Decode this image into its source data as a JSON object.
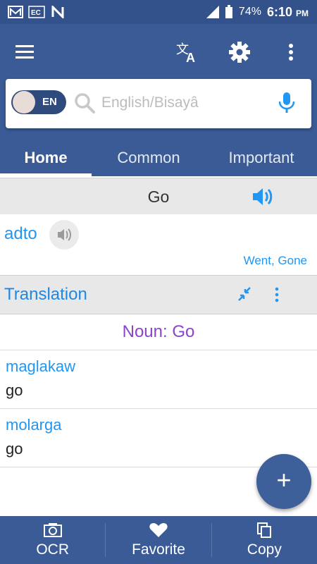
{
  "status_bar": {
    "battery": "74%",
    "time": "6:10",
    "ampm": "PM"
  },
  "app_bar": {
    "icons": [
      "menu-icon",
      "translate-icon",
      "settings-icon",
      "more-vert-icon"
    ]
  },
  "search": {
    "toggle_label": "EN",
    "placeholder": "English/Bisayâ"
  },
  "tabs": [
    {
      "label": "Home",
      "active": true
    },
    {
      "label": "Common",
      "active": false
    },
    {
      "label": "Important",
      "active": false
    }
  ],
  "query": {
    "word": "Go"
  },
  "result": {
    "term": "adto",
    "forms": "Went, Gone"
  },
  "translation": {
    "header": "Translation",
    "part_of_speech": "Noun: Go",
    "entries": [
      {
        "bisaya": "maglakaw",
        "english": "go"
      },
      {
        "bisaya": "molarga",
        "english": "go"
      }
    ]
  },
  "fab": {
    "label": "+"
  },
  "bottom_bar": {
    "items": [
      {
        "label": "OCR",
        "icon": "camera-icon"
      },
      {
        "label": "Favorite",
        "icon": "heart-icon"
      },
      {
        "label": "Copy",
        "icon": "copy-icon"
      }
    ]
  },
  "colors": {
    "primary": "#3a5b96",
    "accent_blue": "#2196f3",
    "pos_purple": "#8e44c8"
  }
}
